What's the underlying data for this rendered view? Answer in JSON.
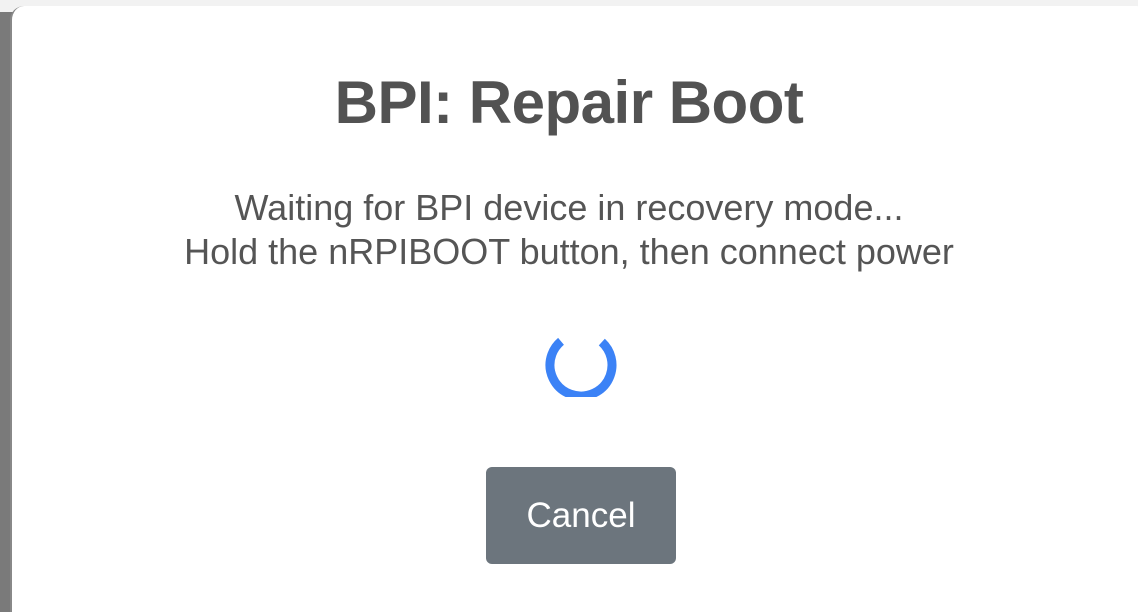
{
  "backdrop": {
    "partial_text": "                                                                                        "
  },
  "dialog": {
    "title": "BPI: Repair Boot",
    "message_lines": [
      "Waiting for BPI device in recovery mode...",
      "Hold the nRPIBOOT button, then connect power"
    ],
    "spinner": {
      "icon": "loading-spinner-icon",
      "color": "#3b82f6"
    },
    "cancel_label": "Cancel"
  },
  "colors": {
    "title_text": "#525252",
    "body_text": "#555555",
    "button_bg": "#6c757d",
    "button_text": "#ffffff"
  }
}
